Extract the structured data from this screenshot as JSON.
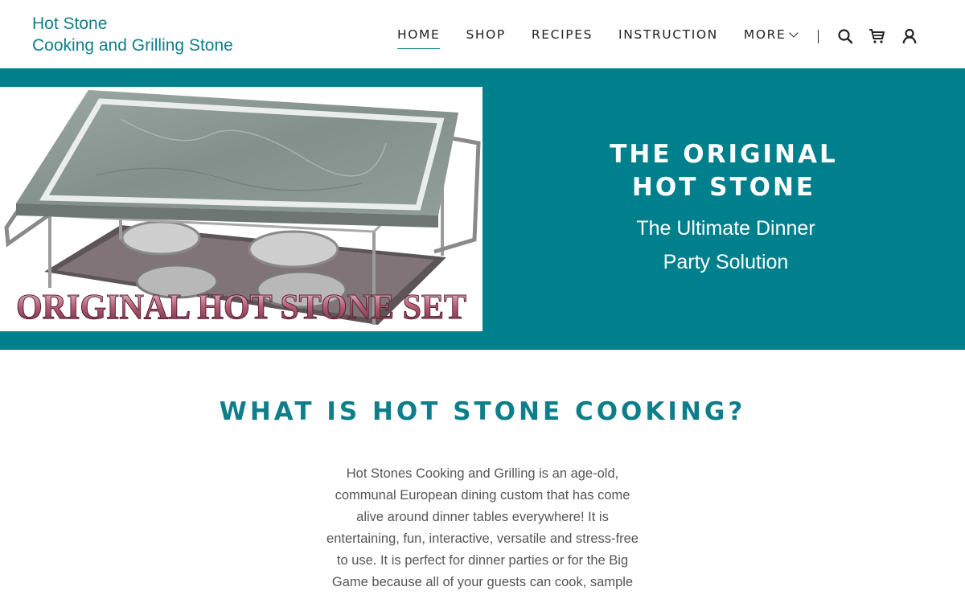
{
  "header": {
    "logo_line1": "Hot Stone",
    "logo_line2": "Cooking and Grilling Stone",
    "nav": [
      {
        "label": "HOME"
      },
      {
        "label": "SHOP"
      },
      {
        "label": "RECIPES"
      },
      {
        "label": "INSTRUCTION"
      },
      {
        "label": "MORE"
      }
    ],
    "icons": [
      "search-icon",
      "cart-icon",
      "account-icon"
    ]
  },
  "hero": {
    "image_caption": "ORIGINAL HOT STONE SET",
    "title_line1": "THE ORIGINAL",
    "title_line2": "HOT STONE",
    "subtitle_line1": "The Ultimate Dinner",
    "subtitle_line2": "Party Solution",
    "accent_color": "#00808c"
  },
  "section": {
    "title": "WHAT IS HOT STONE COOKING?",
    "paragraph_lines": [
      "Hot Stones Cooking and Grilling is an age-old,",
      "communal European dining custom that has come",
      "alive around dinner tables everywhere! It is",
      "entertaining, fun, interactive, versatile and stress-free",
      "to use. It is perfect for dinner parties or for the Big",
      "Game because all of your guests can cook, sample"
    ]
  }
}
